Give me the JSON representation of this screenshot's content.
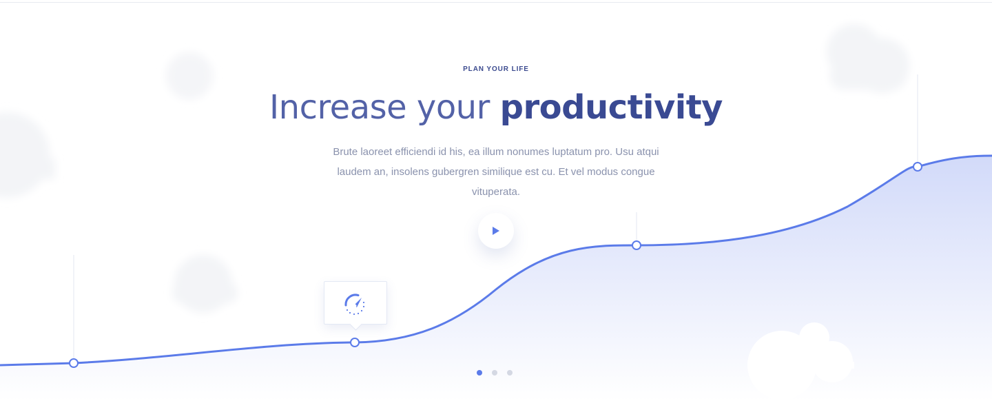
{
  "hero": {
    "eyebrow": "PLAN YOUR LIFE",
    "title_light": "Increase your ",
    "title_bold": "productivity",
    "description": "Brute laoreet efficiendi id his, ea illum nonumes luptatum pro. Usu atqui laudem an, insolens gubergren similique est cu. Et vel modus congue vituperata."
  },
  "controls": {
    "play_icon": "play-icon",
    "tooltip_icon": "speedometer-icon"
  },
  "pager": {
    "count": 3,
    "active_index": 0
  },
  "colors": {
    "accent": "#5b7be9",
    "heading": "#3a4a93",
    "body_text": "#8a92ad",
    "area_fill": "#d3dbfb",
    "pager_inactive": "#d4d8e3"
  }
}
